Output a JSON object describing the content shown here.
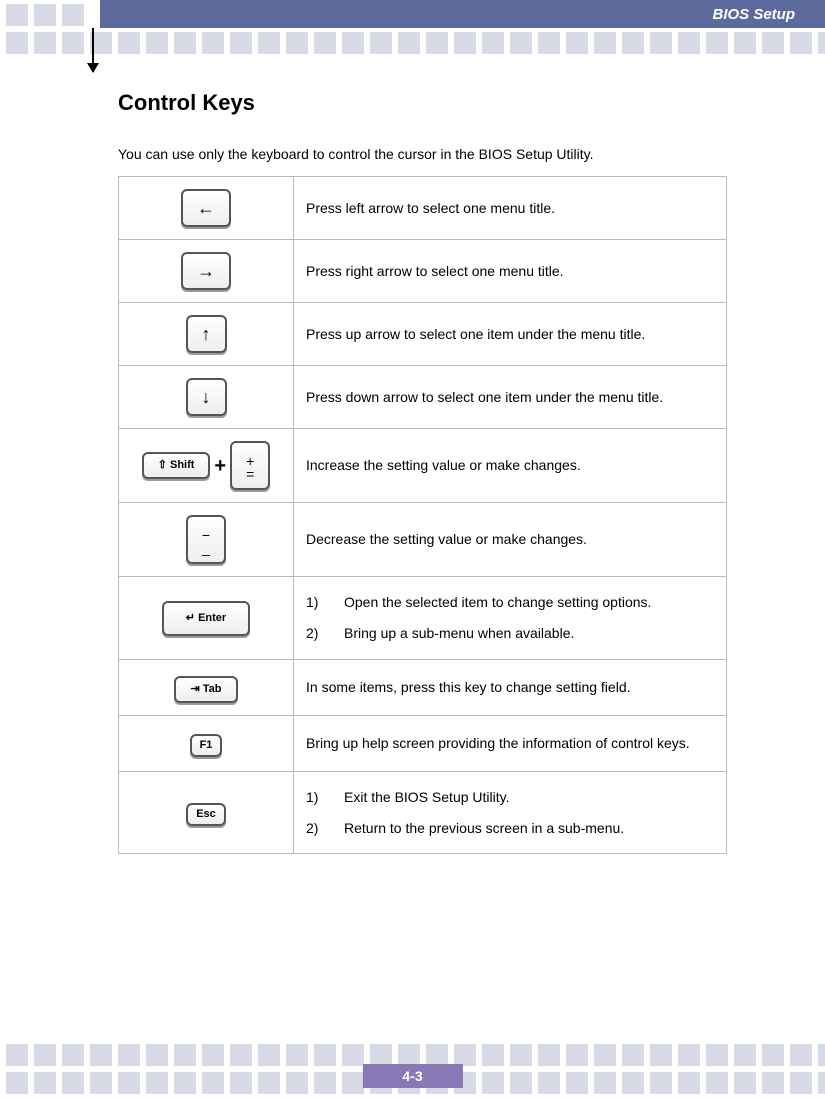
{
  "header": {
    "title": "BIOS Setup"
  },
  "section": {
    "title": "Control Keys",
    "intro": "You can use only the keyboard to control the cursor in the BIOS Setup Utility."
  },
  "rows": [
    {
      "key_label": "←",
      "key_style": "single",
      "desc": "Press left arrow to select one menu title."
    },
    {
      "key_label": "→",
      "key_style": "single",
      "desc": "Press right arrow to select one menu title."
    },
    {
      "key_label": "↑",
      "key_style": "single",
      "desc": "Press up arrow to select one item under the menu title."
    },
    {
      "key_label": "↓",
      "key_style": "single",
      "desc": "Press down arrow to select one item under the menu title."
    },
    {
      "key_label": "Shift + +=",
      "key_style": "shiftplus",
      "shift_text": "⇧ Shift",
      "plus_top": "+",
      "plus_bot": "=",
      "desc": "Increase the setting value or make changes."
    },
    {
      "key_label": "−",
      "key_style": "minus",
      "minus_top": "−",
      "minus_bot": "_",
      "desc": "Decrease the setting value or make changes."
    },
    {
      "key_label": "Enter",
      "key_style": "enter",
      "enter_text": "↵ Enter",
      "desc_list": [
        "Open the selected item to change setting options.",
        "Bring up a sub-menu when available."
      ]
    },
    {
      "key_label": "Tab",
      "key_style": "tab",
      "tab_text": "⇥ Tab",
      "desc": "In some items, press this key to change setting field."
    },
    {
      "key_label": "F1",
      "key_style": "labelkey",
      "text": "F1",
      "desc": "Bring up help screen providing the information of control keys."
    },
    {
      "key_label": "Esc",
      "key_style": "labelkey",
      "text": "Esc",
      "desc_list": [
        "Exit the BIOS Setup Utility.",
        "Return to the previous screen in a sub-menu."
      ]
    }
  ],
  "footer": {
    "page": "4-3"
  }
}
